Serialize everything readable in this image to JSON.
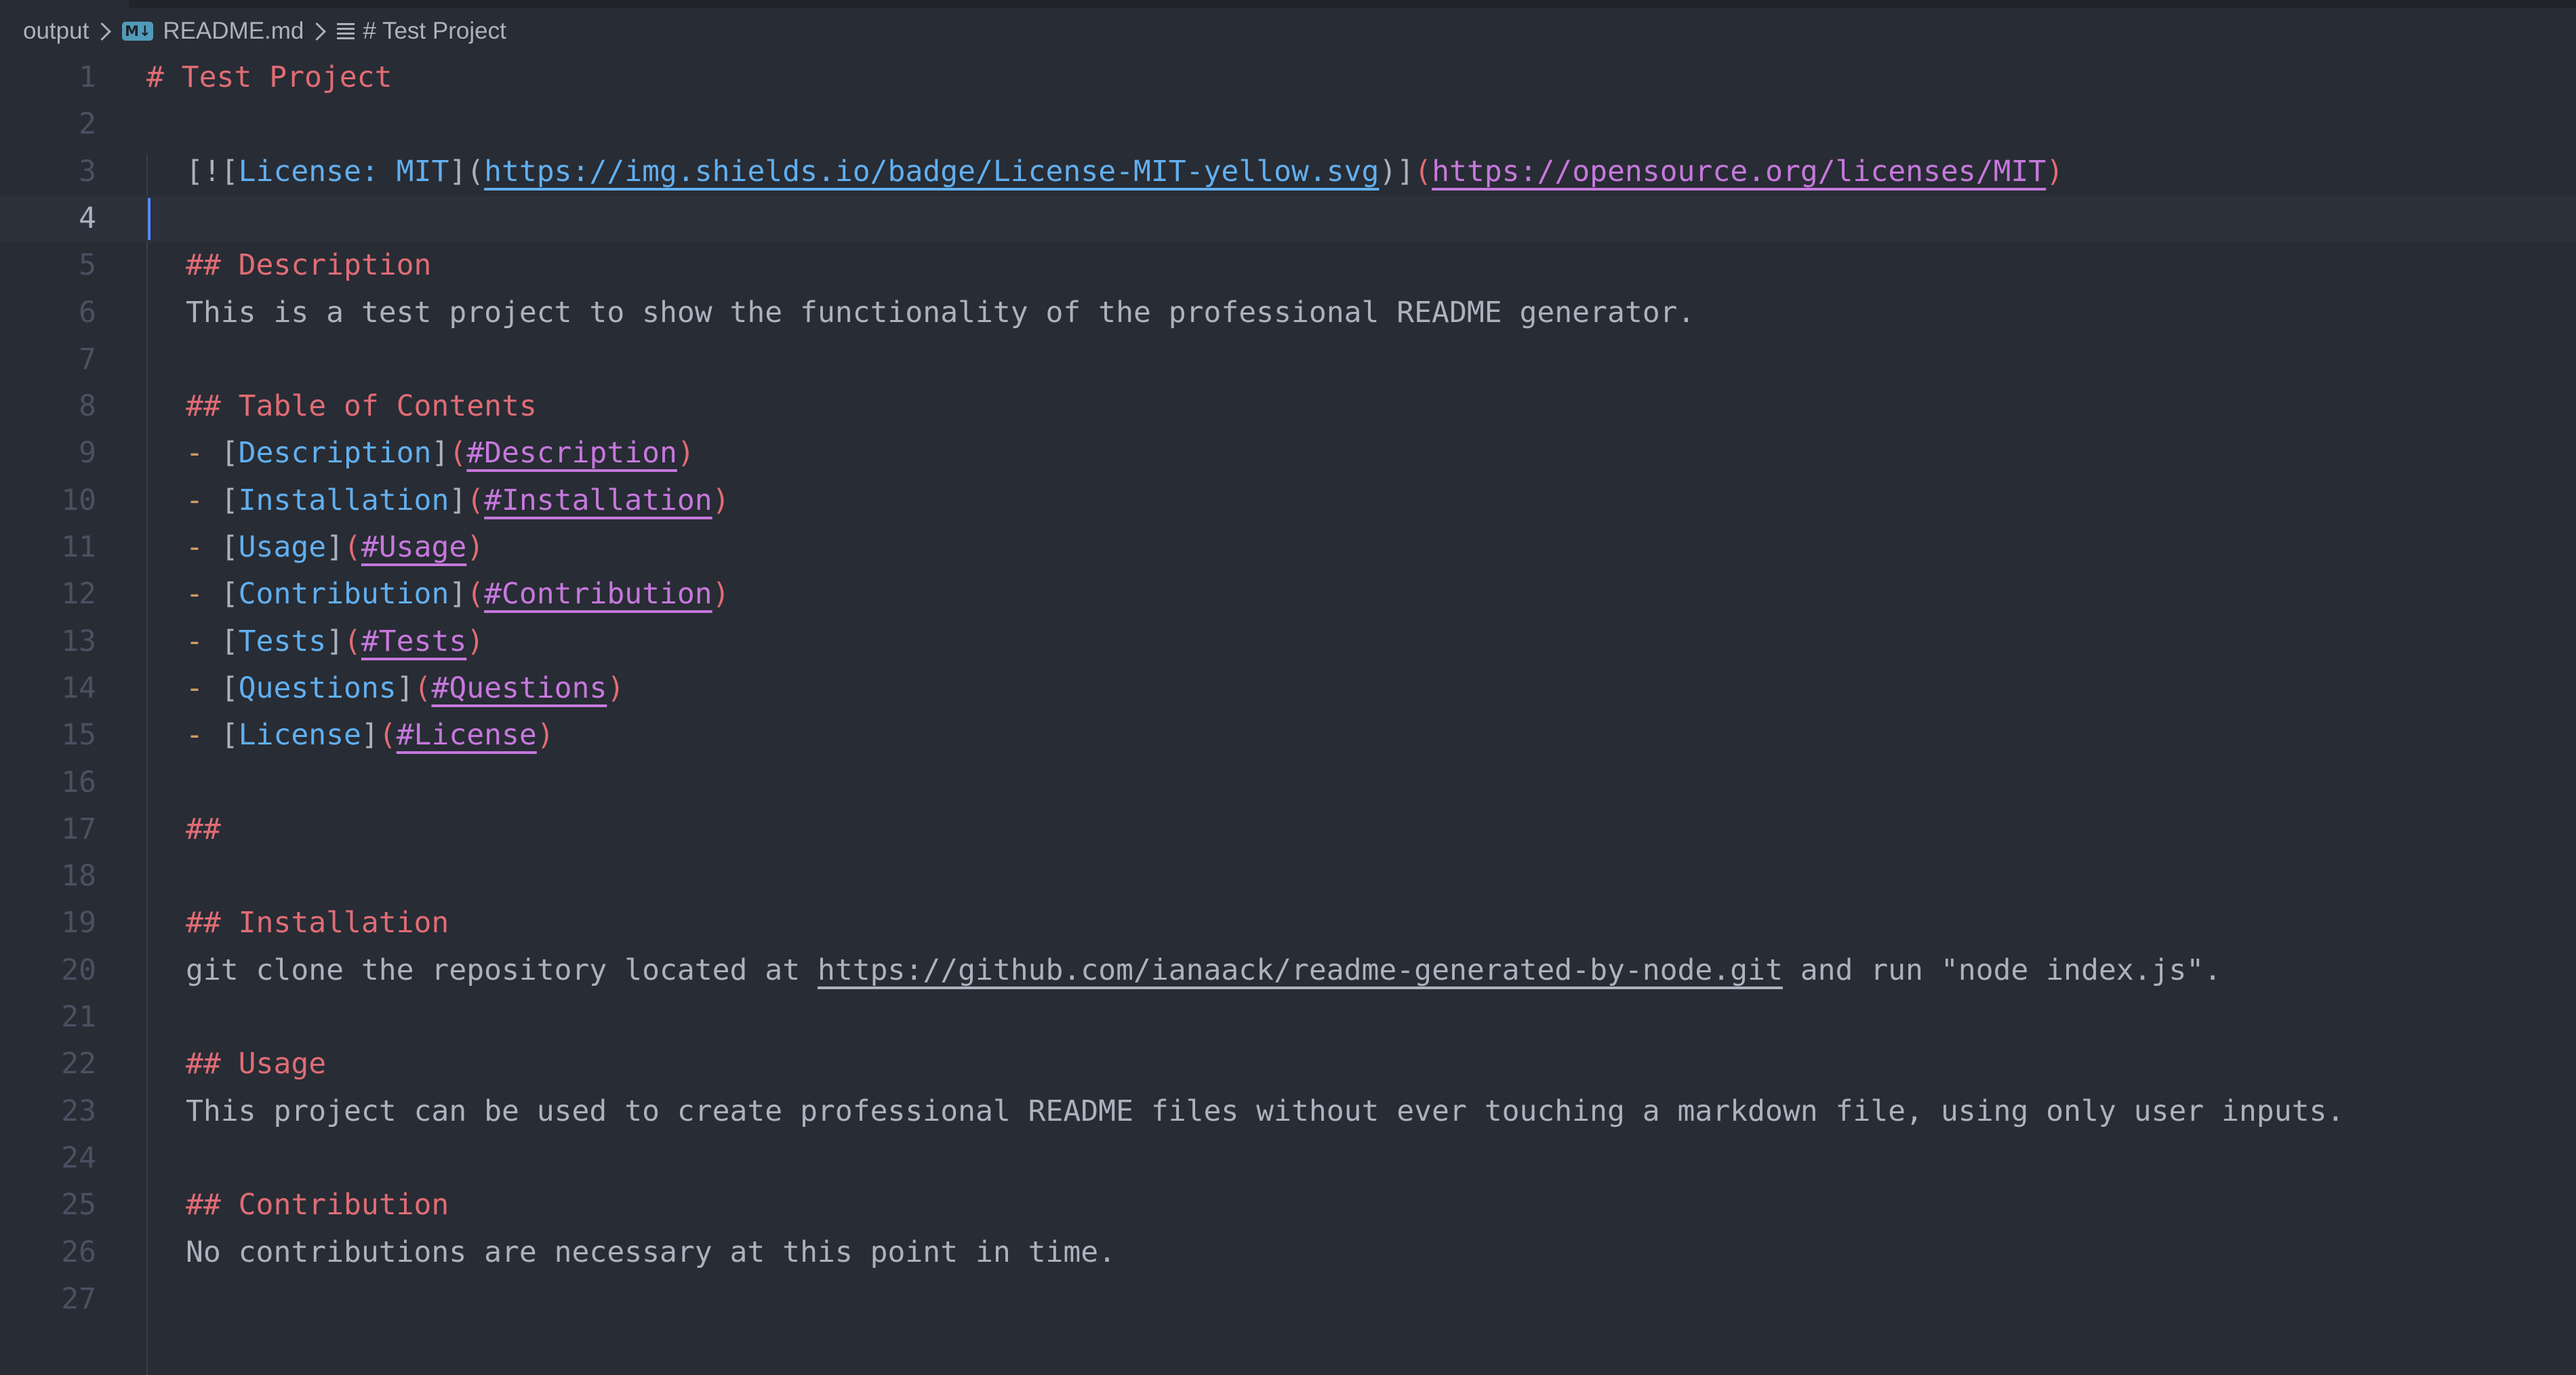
{
  "breadcrumb": {
    "folder": "output",
    "md_badge": "M↓",
    "file": "README.md",
    "symbol": "# Test Project"
  },
  "editor": {
    "active_line": 4,
    "line_numbers": [
      "1",
      "2",
      "3",
      "4",
      "5",
      "6",
      "7",
      "8",
      "9",
      "10",
      "11",
      "12",
      "13",
      "14",
      "15",
      "16",
      "17",
      "18",
      "19",
      "20",
      "21",
      "22",
      "23",
      "24",
      "25",
      "26",
      "27"
    ],
    "lines": {
      "l1": "# Test Project",
      "l3": {
        "open": "[![",
        "alt": "License: MIT",
        "mid": "](",
        "img_url": "https://img.shields.io/badge/License-MIT-yellow.svg",
        "close": ")]",
        "p_open": "(",
        "href": "https://opensource.org/licenses/MIT",
        "p_close": ")"
      },
      "l5": "## Description",
      "l6": "This is a test project to show the functionality of the professional README generator.",
      "l8": "## Table of Contents",
      "toc": [
        {
          "dash": "- ",
          "lb": "[",
          "text": "Description",
          "rb": "]",
          "po": "(",
          "anchor": "#Description",
          "pc": ")"
        },
        {
          "dash": "- ",
          "lb": "[",
          "text": "Installation",
          "rb": "]",
          "po": "(",
          "anchor": "#Installation",
          "pc": ")"
        },
        {
          "dash": "- ",
          "lb": "[",
          "text": "Usage",
          "rb": "]",
          "po": "(",
          "anchor": "#Usage",
          "pc": ")"
        },
        {
          "dash": "- ",
          "lb": "[",
          "text": "Contribution",
          "rb": "]",
          "po": "(",
          "anchor": "#Contribution",
          "pc": ")"
        },
        {
          "dash": "- ",
          "lb": "[",
          "text": "Tests",
          "rb": "]",
          "po": "(",
          "anchor": "#Tests",
          "pc": ")"
        },
        {
          "dash": "- ",
          "lb": "[",
          "text": "Questions",
          "rb": "]",
          "po": "(",
          "anchor": "#Questions",
          "pc": ")"
        },
        {
          "dash": "- ",
          "lb": "[",
          "text": "License",
          "rb": "]",
          "po": "(",
          "anchor": "#License",
          "pc": ")"
        }
      ],
      "l17": "##",
      "l19": "## Installation",
      "l20": {
        "pre": "git clone the repository located at ",
        "url": "https://github.com/ianaack/readme-generated-by-node.git",
        "post": " and run \"node index.js\"."
      },
      "l22": "## Usage",
      "l23": "This project can be used to create professional README files without ever touching a markdown file, using only user inputs.",
      "l25": "## Contribution",
      "l26": "No contributions are necessary at this point in time."
    }
  },
  "colors": {
    "background": "#282c34",
    "heading": "#e06c75",
    "link_text": "#61afef",
    "link_url": "#c678dd",
    "list_marker": "#d19a66",
    "text": "#abb2bf",
    "cursor": "#528bff"
  }
}
